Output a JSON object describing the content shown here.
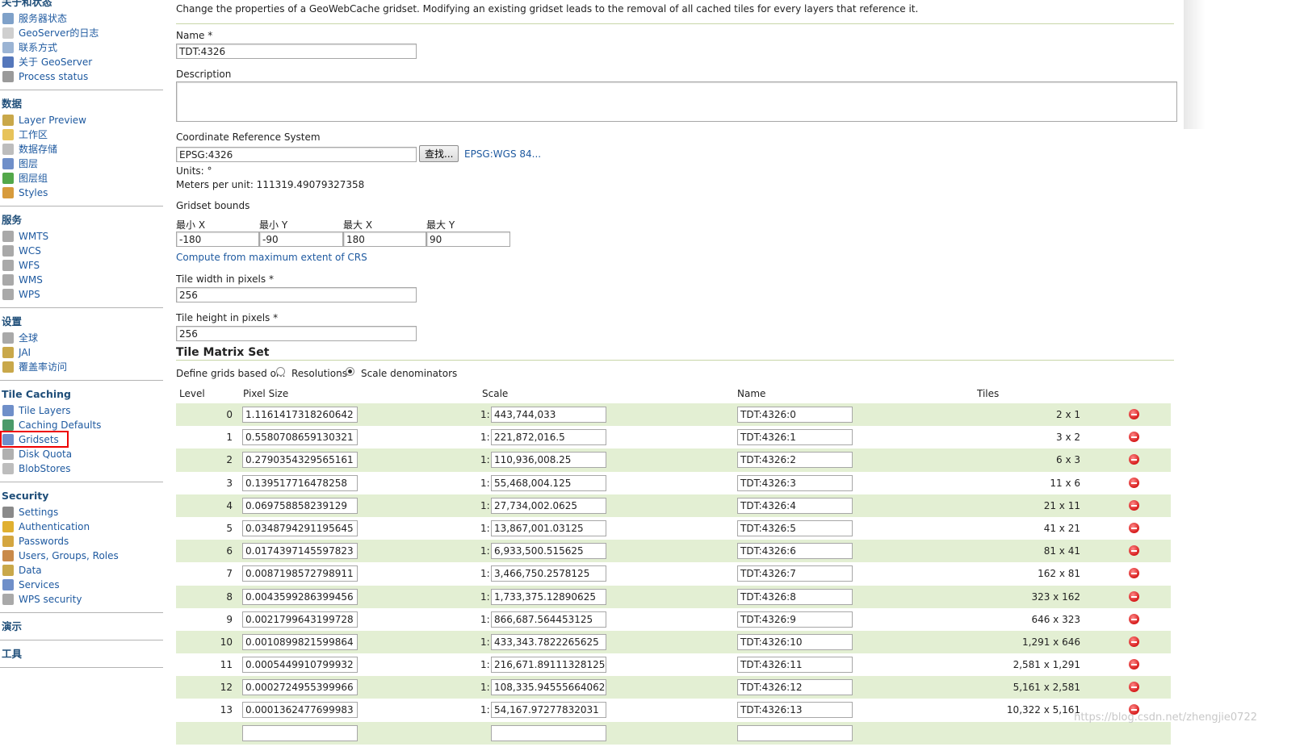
{
  "sidebar": {
    "sections": [
      {
        "title": "关于和状态",
        "items": [
          {
            "label": "服务器状态",
            "icon": "server-status-icon",
            "color": "#7fa1c9"
          },
          {
            "label": "GeoServer的日志",
            "icon": "log-icon",
            "color": "#cfcfcf"
          },
          {
            "label": "联系方式",
            "icon": "contact-icon",
            "color": "#9bb4d4"
          },
          {
            "label": "关于 GeoServer",
            "icon": "about-icon",
            "color": "#5577bb"
          },
          {
            "label": "Process status",
            "icon": "process-gear-icon",
            "color": "#9a9a9a"
          }
        ]
      },
      {
        "title": "数据",
        "items": [
          {
            "label": "Layer Preview",
            "icon": "layer-preview-icon",
            "color": "#c9a84a"
          },
          {
            "label": "工作区",
            "icon": "folder-icon",
            "color": "#e7c35a"
          },
          {
            "label": "数据存储",
            "icon": "database-icon",
            "color": "#bdbdbd"
          },
          {
            "label": "图层",
            "icon": "layer-icon",
            "color": "#6f8fc9"
          },
          {
            "label": "图层组",
            "icon": "layer-group-icon",
            "color": "#53a84a"
          },
          {
            "label": "Styles",
            "icon": "palette-icon",
            "color": "#d79b3c"
          }
        ]
      },
      {
        "title": "服务",
        "items": [
          {
            "label": "WMTS",
            "icon": "service-icon",
            "color": "#a9a9a9"
          },
          {
            "label": "WCS",
            "icon": "service-icon",
            "color": "#a9a9a9"
          },
          {
            "label": "WFS",
            "icon": "service-icon",
            "color": "#a9a9a9"
          },
          {
            "label": "WMS",
            "icon": "service-icon",
            "color": "#a9a9a9"
          },
          {
            "label": "WPS",
            "icon": "service-icon",
            "color": "#a9a9a9"
          }
        ]
      },
      {
        "title": "设置",
        "items": [
          {
            "label": "全球",
            "icon": "global-icon",
            "color": "#a9a9a9"
          },
          {
            "label": "JAI",
            "icon": "jai-icon",
            "color": "#c9a84a"
          },
          {
            "label": "覆盖率访问",
            "icon": "coverage-icon",
            "color": "#c9a84a"
          }
        ]
      },
      {
        "title": "Tile Caching",
        "items": [
          {
            "label": "Tile Layers",
            "icon": "tile-layers-icon",
            "color": "#6f8fc9"
          },
          {
            "label": "Caching Defaults",
            "icon": "globe-icon",
            "color": "#4a9a6a"
          },
          {
            "label": "Gridsets",
            "icon": "grid-icon",
            "color": "#6f8fc9",
            "highlight": true
          },
          {
            "label": "Disk Quota",
            "icon": "disk-icon",
            "color": "#b0b0b0"
          },
          {
            "label": "BlobStores",
            "icon": "blobstore-icon",
            "color": "#bdbdbd"
          }
        ]
      },
      {
        "title": "Security",
        "items": [
          {
            "label": "Settings",
            "icon": "key-icon",
            "color": "#8a8a8a"
          },
          {
            "label": "Authentication",
            "icon": "shield-icon",
            "color": "#e0b030"
          },
          {
            "label": "Passwords",
            "icon": "lock-icon",
            "color": "#d4a640"
          },
          {
            "label": "Users, Groups, Roles",
            "icon": "users-icon",
            "color": "#c98a4a"
          },
          {
            "label": "Data",
            "icon": "data-icon",
            "color": "#c9a84a"
          },
          {
            "label": "Services",
            "icon": "services-icon",
            "color": "#6f8fc9"
          },
          {
            "label": "WPS security",
            "icon": "wps-security-icon",
            "color": "#a9a9a9"
          }
        ]
      },
      {
        "title": "演示",
        "items": []
      },
      {
        "title": "工具",
        "items": []
      }
    ]
  },
  "form": {
    "description_text": "Change the properties of a GeoWebCache gridset. Modifying an existing gridset leads to the removal of all cached tiles for every layers that reference it.",
    "name_label": "Name *",
    "name_value": "TDT:4326",
    "description_label": "Description",
    "description_value": "",
    "crs_label": "Coordinate Reference System",
    "crs_value": "EPSG:4326",
    "find_button": "查找...",
    "crs_link": "EPSG:WGS 84...",
    "units": "Units: °",
    "meters_per_unit": "Meters per unit: 111319.49079327358",
    "bounds_label": "Gridset bounds",
    "bounds": [
      {
        "label": "最小 X",
        "value": "-180"
      },
      {
        "label": "最小 Y",
        "value": "-90"
      },
      {
        "label": "最大 X",
        "value": "180"
      },
      {
        "label": "最大 Y",
        "value": "90"
      }
    ],
    "compute_link": "Compute from maximum extent of CRS",
    "tile_width_label": "Tile width in pixels *",
    "tile_width": "256",
    "tile_height_label": "Tile height in pixels *",
    "tile_height": "256"
  },
  "tile_matrix": {
    "title": "Tile Matrix Set",
    "define_label": "Define grids based on:",
    "option_resolutions": "Resolutions",
    "option_scale": "Scale denominators",
    "selected": "Scale denominators",
    "columns": {
      "level": "Level",
      "pixel": "Pixel Size",
      "scale": "Scale",
      "name": "Name",
      "tiles": "Tiles"
    },
    "scale_prefix": "1:",
    "rows": [
      {
        "level": "0",
        "pixel": "1.1161417318260642",
        "scale": "443,744,033",
        "name": "TDT:4326:0",
        "tiles": "2 x 1"
      },
      {
        "level": "1",
        "pixel": "0.5580708659130321",
        "scale": "221,872,016.5",
        "name": "TDT:4326:1",
        "tiles": "3 x 2"
      },
      {
        "level": "2",
        "pixel": "0.2790354329565161",
        "scale": "110,936,008.25",
        "name": "TDT:4326:2",
        "tiles": "6 x 3"
      },
      {
        "level": "3",
        "pixel": "0.139517716478258",
        "scale": "55,468,004.125",
        "name": "TDT:4326:3",
        "tiles": "11 x 6"
      },
      {
        "level": "4",
        "pixel": "0.069758858239129",
        "scale": "27,734,002.0625",
        "name": "TDT:4326:4",
        "tiles": "21 x 11"
      },
      {
        "level": "5",
        "pixel": "0.0348794291195645",
        "scale": "13,867,001.03125",
        "name": "TDT:4326:5",
        "tiles": "41 x 21"
      },
      {
        "level": "6",
        "pixel": "0.0174397145597823",
        "scale": "6,933,500.515625",
        "name": "TDT:4326:6",
        "tiles": "81 x 41"
      },
      {
        "level": "7",
        "pixel": "0.0087198572798911",
        "scale": "3,466,750.2578125",
        "name": "TDT:4326:7",
        "tiles": "162 x 81"
      },
      {
        "level": "8",
        "pixel": "0.0043599286399456",
        "scale": "1,733,375.12890625",
        "name": "TDT:4326:8",
        "tiles": "323 x 162"
      },
      {
        "level": "9",
        "pixel": "0.0021799643199728",
        "scale": "866,687.564453125",
        "name": "TDT:4326:9",
        "tiles": "646 x 323"
      },
      {
        "level": "10",
        "pixel": "0.0010899821599864",
        "scale": "433,343.7822265625",
        "name": "TDT:4326:10",
        "tiles": "1,291 x 646"
      },
      {
        "level": "11",
        "pixel": "0.0005449910799932",
        "scale": "216,671.89111328125",
        "name": "TDT:4326:11",
        "tiles": "2,581 x 1,291"
      },
      {
        "level": "12",
        "pixel": "0.0002724955399966",
        "scale": "108,335.94555664062",
        "name": "TDT:4326:12",
        "tiles": "5,161 x 2,581"
      },
      {
        "level": "13",
        "pixel": "0.0001362477699983",
        "scale": "54,167.97277832031",
        "name": "TDT:4326:13",
        "tiles": "10,322 x 5,161"
      }
    ]
  },
  "watermark": "https://blog.csdn.net/zhengjie0722",
  "colors": {
    "link": "#1f5aa0",
    "row_alt": "#e3efd3",
    "highlight": "#ee0000"
  }
}
